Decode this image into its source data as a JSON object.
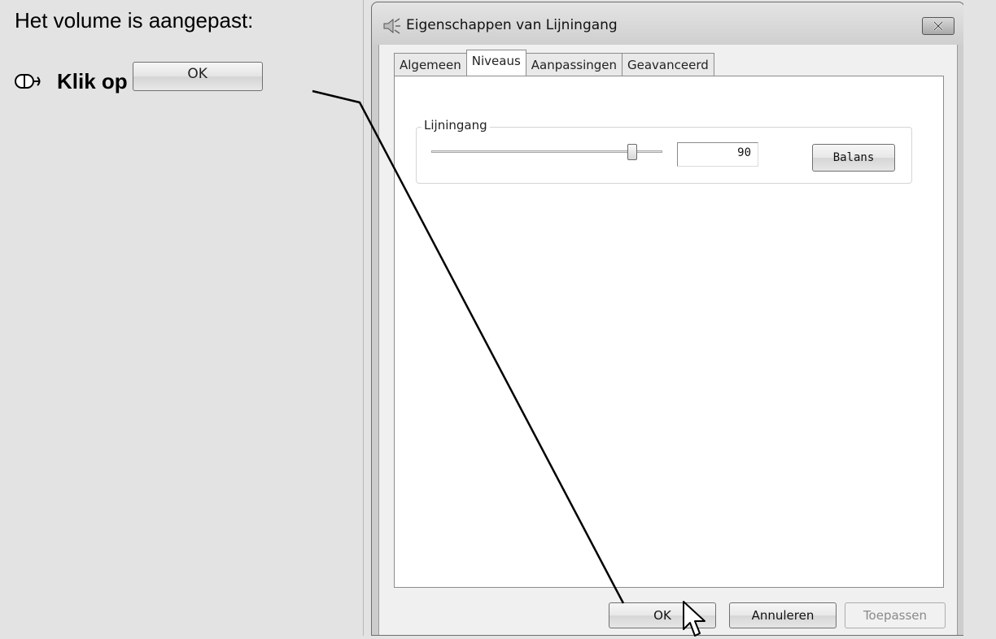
{
  "instruction": {
    "text": "Het volume is aangepast:",
    "step_text": "Klik op",
    "button_image_label": "OK",
    "mouse_icon": "mouse-icon"
  },
  "window": {
    "title": "Eigenschappen van Lijningang",
    "title_icon": "speaker-icon",
    "close_icon": "close-icon",
    "tabs": [
      {
        "label": "Algemeen",
        "active": false
      },
      {
        "label": "Niveaus",
        "active": true
      },
      {
        "label": "Aanpassingen",
        "active": false
      },
      {
        "label": "Geavanceerd",
        "active": false
      }
    ],
    "group_label": "Lijningang",
    "level_value": "90",
    "slider_level": 90,
    "balance_label": "Balans",
    "buttons": {
      "ok": "OK",
      "cancel": "Annuleren",
      "apply": "Toepassen"
    }
  },
  "colors": {
    "background": "#e3e3e3",
    "window_frame": "#cdcdcd",
    "panel": "#ffffff"
  }
}
